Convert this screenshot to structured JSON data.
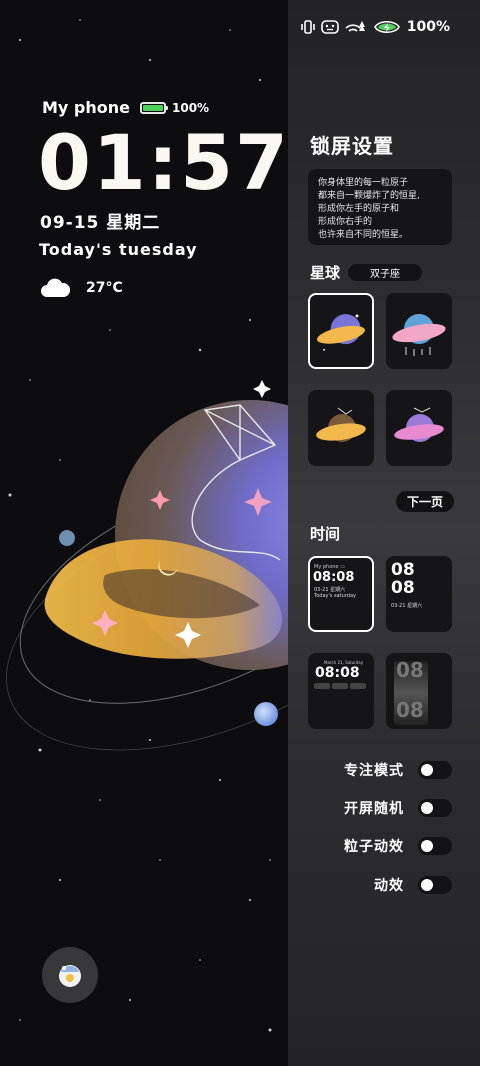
{
  "lock_screen": {
    "device_name": "My phone",
    "battery_percent": "100%",
    "time": "01:57",
    "date": "09-15  星期二",
    "greeting": "Today's  tuesday",
    "weather": {
      "icon": "cloud-icon",
      "temperature": "27°C"
    }
  },
  "status_bar": {
    "icons": [
      "vibrate-icon",
      "face-icon",
      "wifi-icon",
      "battery-charging-icon"
    ],
    "battery_percent": "100%"
  },
  "panel": {
    "title": "锁屏设置",
    "quote_lines": [
      "你身体里的每一粒原子",
      "都来自一颗爆炸了的恒星,",
      "形成你左手的原子和",
      "形成你右手的",
      "也许来自不同的恒星。"
    ],
    "planet_section": {
      "label": "星球",
      "selected_name": "双子座",
      "next_label": "下一页"
    },
    "time_section": {
      "label": "时间",
      "styles": [
        {
          "time": "08:08",
          "date": "03-21 星期六",
          "greeting": "Today's saturday"
        },
        {
          "hour": "08",
          "minute": "08",
          "date": "03-21 星期六"
        },
        {
          "date": "March 21, Saturday",
          "time": "08:08"
        },
        {
          "hour": "08",
          "minute": "08"
        }
      ]
    },
    "toggles": [
      {
        "label": "专注模式",
        "on": false
      },
      {
        "label": "开屏随机",
        "on": false
      },
      {
        "label": "粒子动效",
        "on": false
      },
      {
        "label": "动效",
        "on": false
      }
    ]
  },
  "colors": {
    "battery_green": "#4fd15a",
    "panel_bg": "#2e2e31",
    "card_bg": "#151517"
  }
}
